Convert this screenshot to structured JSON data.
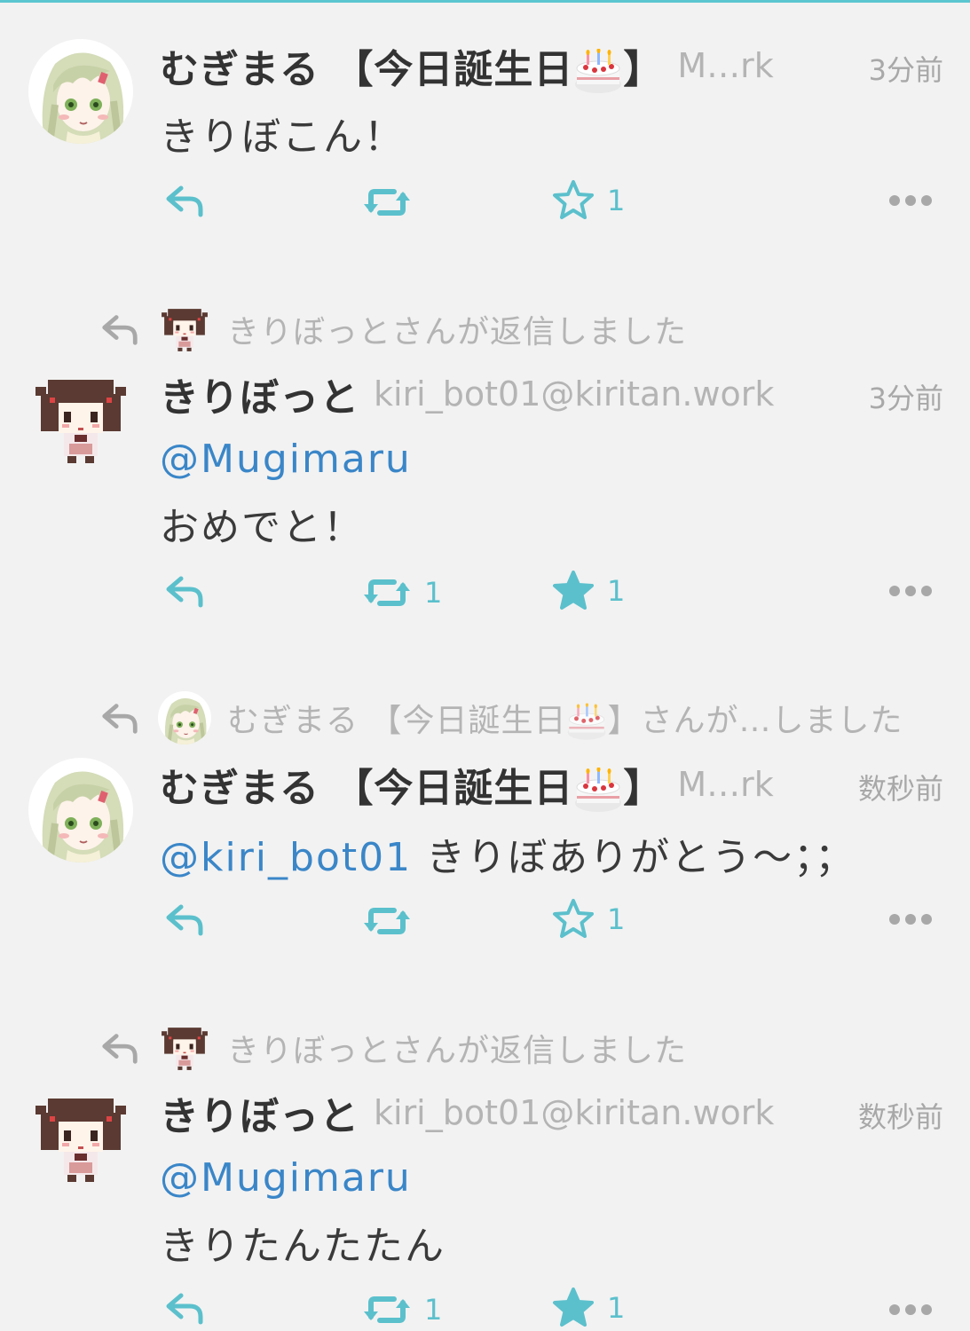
{
  "colors": {
    "accent": "#5bc0cc",
    "mention": "#3a86c8",
    "muted": "#b4b4b4",
    "background": "#f2f2f2"
  },
  "posts": [
    {
      "display_name": "むぎまる 【今日誕生日",
      "display_name_suffix": "】",
      "acct": "M…rk",
      "time": "3分前",
      "mention": "",
      "text": "きりぼこん！",
      "boost_count": "",
      "fav_count": "1",
      "fav_filled": false
    },
    {
      "context": "きりぼっとさんが返信しました",
      "display_name": "きりぼっと",
      "acct": "kiri_bot01@kiritan.work",
      "time": "3分前",
      "mention": "@Mugimaru",
      "text": "おめでと！",
      "boost_count": "1",
      "fav_count": "1",
      "fav_filled": true
    },
    {
      "context_prefix": "むぎまる 【今日誕生日",
      "context_suffix": "】さんが…しました",
      "display_name": "むぎまる 【今日誕生日",
      "display_name_suffix": "】",
      "acct": "M…rk",
      "time": "数秒前",
      "mention": "@kiri_bot01",
      "text": "きりぼありがとう〜；；",
      "boost_count": "",
      "fav_count": "1",
      "fav_filled": false
    },
    {
      "context": "きりぼっとさんが返信しました",
      "display_name": "きりぼっと",
      "acct": "kiri_bot01@kiritan.work",
      "time": "数秒前",
      "mention": "@Mugimaru",
      "text": "きりたんたたん",
      "boost_count": "1",
      "fav_count": "1",
      "fav_filled": true
    }
  ]
}
